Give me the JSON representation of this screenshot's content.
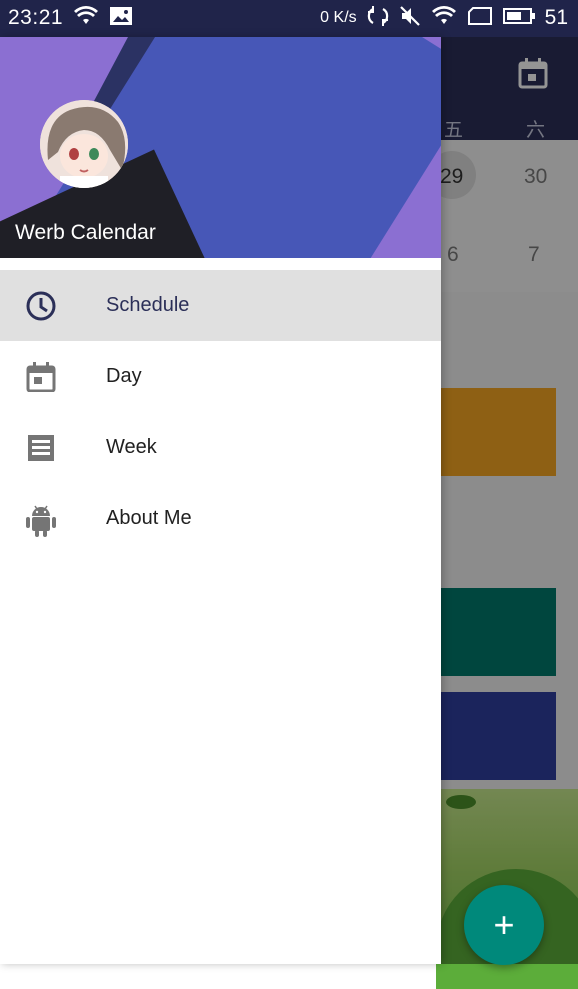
{
  "status_bar": {
    "time": "23:21",
    "net_speed": "0 K/s",
    "battery": "51"
  },
  "background_app": {
    "weekdays": [
      "五",
      "六"
    ],
    "dates_row1": [
      "29",
      "30"
    ],
    "dates_row2": [
      "6",
      "7"
    ],
    "event_colors": [
      "#f5a623",
      "#00796b",
      "#303f9f"
    ],
    "fab_label": "+"
  },
  "drawer": {
    "header_title": "Werb Calendar",
    "menu": [
      {
        "label": "Schedule",
        "icon": "clock-icon",
        "selected": true
      },
      {
        "label": "Day",
        "icon": "calendar-day-icon",
        "selected": false
      },
      {
        "label": "Week",
        "icon": "receipt-list-icon",
        "selected": false
      },
      {
        "label": "About Me",
        "icon": "android-icon",
        "selected": false
      }
    ]
  },
  "colors": {
    "primary_dark": "#20244a",
    "primary": "#2b2f58",
    "accent": "#00897b",
    "selected_bg": "#e0e0e0"
  }
}
